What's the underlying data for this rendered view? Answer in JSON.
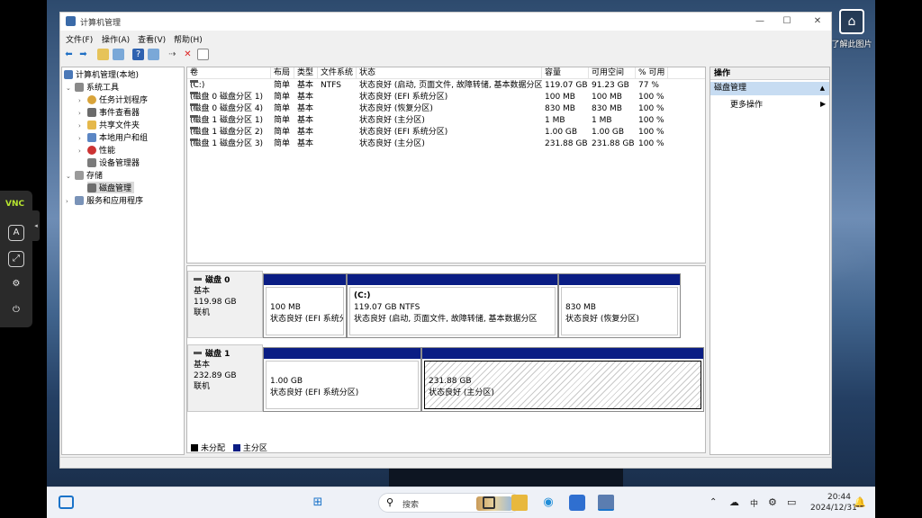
{
  "desktop": {
    "icon_label": "了解此图片"
  },
  "vnc": {
    "logo": "VNC"
  },
  "window": {
    "title": "计算机管理",
    "controls": {
      "minimize": "—",
      "maximize": "☐",
      "close": "✕"
    }
  },
  "menu": [
    "文件(F)",
    "操作(A)",
    "查看(V)",
    "帮助(H)"
  ],
  "tree": {
    "root": "计算机管理(本地)",
    "items": [
      {
        "label": "系统工具"
      },
      {
        "label": "任务计划程序"
      },
      {
        "label": "事件查看器"
      },
      {
        "label": "共享文件夹"
      },
      {
        "label": "本地用户和组"
      },
      {
        "label": "性能"
      },
      {
        "label": "设备管理器"
      },
      {
        "label": "存储"
      },
      {
        "label": "磁盘管理"
      },
      {
        "label": "服务和应用程序"
      }
    ]
  },
  "volumes": {
    "columns": [
      "卷",
      "布局",
      "类型",
      "文件系统",
      "状态",
      "容量",
      "可用空间",
      "% 可用"
    ],
    "rows": [
      {
        "name": "(C:)",
        "layout": "简单",
        "type": "基本",
        "fs": "NTFS",
        "status": "状态良好 (启动, 页面文件, 故障转储, 基本数据分区)",
        "capacity": "119.07 GB",
        "free": "91.23 GB",
        "pct": "77 %"
      },
      {
        "name": "(磁盘 0 磁盘分区 1)",
        "layout": "简单",
        "type": "基本",
        "fs": "",
        "status": "状态良好 (EFI 系统分区)",
        "capacity": "100 MB",
        "free": "100 MB",
        "pct": "100 %"
      },
      {
        "name": "(磁盘 0 磁盘分区 4)",
        "layout": "简单",
        "type": "基本",
        "fs": "",
        "status": "状态良好 (恢复分区)",
        "capacity": "830 MB",
        "free": "830 MB",
        "pct": "100 %"
      },
      {
        "name": "(磁盘 1 磁盘分区 1)",
        "layout": "简单",
        "type": "基本",
        "fs": "",
        "status": "状态良好 (主分区)",
        "capacity": "1 MB",
        "free": "1 MB",
        "pct": "100 %"
      },
      {
        "name": "(磁盘 1 磁盘分区 2)",
        "layout": "简单",
        "type": "基本",
        "fs": "",
        "status": "状态良好 (EFI 系统分区)",
        "capacity": "1.00 GB",
        "free": "1.00 GB",
        "pct": "100 %"
      },
      {
        "name": "(磁盘 1 磁盘分区 3)",
        "layout": "简单",
        "type": "基本",
        "fs": "",
        "status": "状态良好 (主分区)",
        "capacity": "231.88 GB",
        "free": "231.88 GB",
        "pct": "100 %"
      }
    ]
  },
  "disks": [
    {
      "name": "磁盘 0",
      "type": "基本",
      "size": "119.98 GB",
      "state": "联机",
      "partitions": [
        {
          "title": "",
          "size": "100 MB",
          "status": "状态良好 (EFI 系统分"
        },
        {
          "title": "(C:)",
          "size": "119.07 GB NTFS",
          "status": "状态良好 (启动, 页面文件, 故障转储, 基本数据分区"
        },
        {
          "title": "",
          "size": "830 MB",
          "status": "状态良好 (恢复分区)"
        }
      ]
    },
    {
      "name": "磁盘 1",
      "type": "基本",
      "size": "232.89 GB",
      "state": "联机",
      "partitions": [
        {
          "title": "",
          "size": "1.00 GB",
          "status": "状态良好 (EFI 系统分区)"
        },
        {
          "title": "",
          "size": "231.88 GB",
          "status": "状态良好 (主分区)"
        }
      ]
    }
  ],
  "legend": {
    "unallocated": "未分配",
    "primary": "主分区"
  },
  "actions": {
    "header": "操作",
    "selected": "磁盘管理",
    "more": "更多操作"
  },
  "taskbar": {
    "search_placeholder": "搜索",
    "ime": "中",
    "time": "20:44",
    "date": "2024/12/31"
  },
  "colors": {
    "partition_bar": "#0a1d84",
    "selection": "#c7dcf2",
    "unallocated": "#000000"
  }
}
